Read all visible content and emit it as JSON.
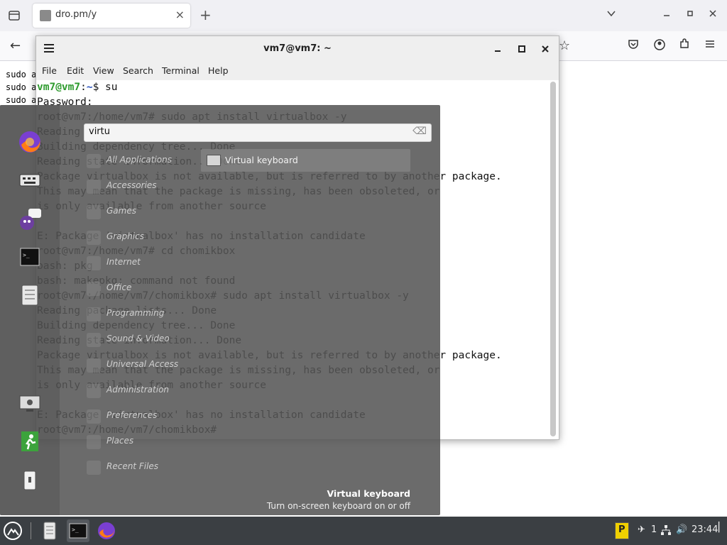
{
  "browser": {
    "tab_title": "dro.pm/y",
    "tab_close": "×",
    "new_tab": "+",
    "back": "←",
    "bookmark": "☆",
    "page_lines": [
      "sudo a",
      "sudo a",
      "sudo a"
    ]
  },
  "terminal": {
    "title": "vm7@vm7: ~",
    "menu": [
      "File",
      "Edit",
      "View",
      "Search",
      "Terminal",
      "Help"
    ],
    "lines": [
      "vm7@vm7:~$ su",
      "Password:",
      "root@vm7:/home/vm7# sudo apt install virtualbox -y",
      "Reading package lists... Done",
      "Building dependency tree... Done",
      "Reading state information... Done",
      "Package virtualbox is not available, but is referred to by another package.",
      "This may mean that the package is missing, has been obsoleted, or",
      "is only available from another source",
      "",
      "E: Package 'virtualbox' has no installation candidate",
      "root@vm7:/home/vm7# cd chomikbox",
      "bash: pkg",
      "bash: makepkg: command not found",
      "root@vm7:/home/vm7/chomikbox# sudo apt install virtualbox -y",
      "Reading package lists... Done",
      "Building dependency tree... Done",
      "Reading state information... Done",
      "Package virtualbox is not available, but is referred to by another package.",
      "This may mean that the package is missing, has been obsoleted, or",
      "is only available from another source",
      "",
      "E: Package 'virtualbox' has no installation candidate",
      "root@vm7:/home/vm7/chomikbox# "
    ]
  },
  "menu": {
    "search_value": "virtu",
    "categories": [
      "All Applications",
      "Accessories",
      "Games",
      "Graphics",
      "Internet",
      "Office",
      "Programming",
      "Sound & Video",
      "Universal Access",
      "Administration",
      "Preferences",
      "Places",
      "Recent Files"
    ],
    "result": "Virtual keyboard",
    "description_title": "Virtual keyboard",
    "description_text": "Turn on-screen keyboard on or off"
  },
  "taskbar": {
    "tray_count": "1",
    "clock": "23:44"
  }
}
